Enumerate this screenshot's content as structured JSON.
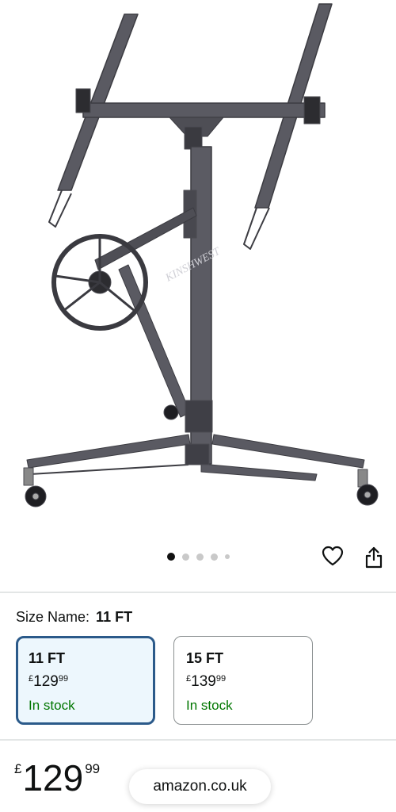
{
  "product": {
    "image_alt": "Drywall panel hoist lift",
    "watermark": "KINSHWEST"
  },
  "carousel": {
    "image_count": 5,
    "active_index": 0
  },
  "actions": {
    "wishlist_icon": "heart-icon",
    "share_icon": "share-icon"
  },
  "size": {
    "label": "Size Name:",
    "selected_value": "11 FT",
    "options": [
      {
        "name": "11 FT",
        "currency": "£",
        "whole": "129",
        "fraction": "99",
        "availability": "In stock",
        "selected": true
      },
      {
        "name": "15 FT",
        "currency": "£",
        "whole": "139",
        "fraction": "99",
        "availability": "In stock",
        "selected": false
      }
    ]
  },
  "price": {
    "currency": "£",
    "whole": "129",
    "fraction": "99"
  },
  "browser": {
    "url": "amazon.co.uk"
  },
  "colors": {
    "in_stock": "#007600",
    "selected_border": "#2b5a8a",
    "selected_bg": "#edf7fd",
    "frame": "#4a4a50"
  }
}
